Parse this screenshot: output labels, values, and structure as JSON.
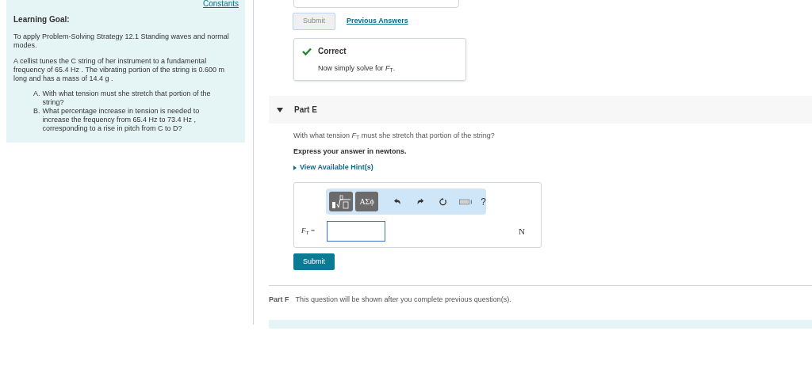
{
  "sidebar": {
    "constants_link": "Constants",
    "heading": "Learning Goal:",
    "paragraphs": [
      "To apply Problem-Solving Strategy 12.1 Standing waves and normal modes.",
      "A cellist tunes the C string of her instrument to a fundamental frequency of 65.4 Hz . The vibrating portion of the string is 0.600 m long and has a mass of 14.4 g ."
    ],
    "questions": [
      {
        "marker": "A.",
        "text": "With what tension must she stretch that portion of the string?"
      },
      {
        "marker": "B.",
        "text": "What percentage increase in tension is needed to increase the frequency from 65.4 Hz to 73.4 Hz , corresponding to a rise in pitch from C to D?"
      }
    ]
  },
  "previous_part": {
    "submit_button": {
      "label": "Submit",
      "disabled": true
    },
    "previous_answers_link": "Previous Answers",
    "feedback": {
      "title": "Correct",
      "message": "Now simply solve for *F*$_{T}$."
    }
  },
  "part_e": {
    "label": "Part E",
    "expanded": true,
    "question": "With what tension *F*$_{T}$ must she stretch that portion of the string?",
    "instruction": "Express your answer in newtons.",
    "hints_link": "View Available Hint(s)",
    "symbols_button": "ΑΣϕ",
    "help_button": "?",
    "answer_label": "*F*$_{T}$ =",
    "unit": "N",
    "submit_button": {
      "label": "Submit",
      "disabled": false
    }
  },
  "part_f": {
    "label": "Part F",
    "message": "This question will be shown after you complete previous question(s)."
  }
}
